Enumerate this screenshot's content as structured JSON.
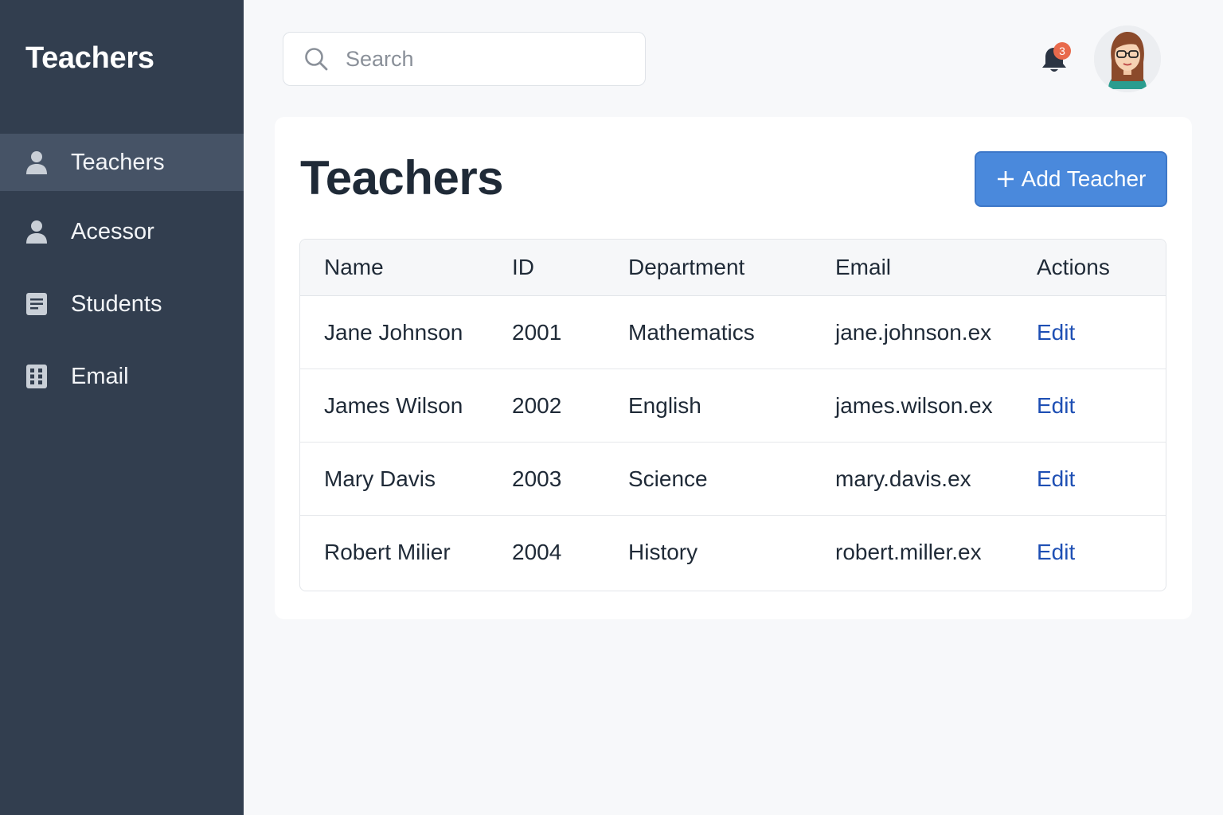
{
  "sidebar": {
    "title": "Teachers",
    "items": [
      {
        "label": "Teachers",
        "icon": "user-icon",
        "active": true
      },
      {
        "label": "Acessor",
        "icon": "user-icon",
        "active": false
      },
      {
        "label": "Students",
        "icon": "document-icon",
        "active": false
      },
      {
        "label": "Email",
        "icon": "grid-icon",
        "active": false
      }
    ]
  },
  "header": {
    "search_placeholder": "Search",
    "notifications_count": "3"
  },
  "main": {
    "title": "Teachers",
    "add_button_label": "Add Teacher",
    "table": {
      "columns": [
        "Name",
        "ID",
        "Department",
        "Email",
        "Actions"
      ],
      "rows": [
        {
          "name": "Jane Johnson",
          "id": "2001",
          "department": "Mathematics",
          "email": "jane.johnson.ex",
          "action": "Edit"
        },
        {
          "name": "James Wilson",
          "id": "2002",
          "department": "English",
          "email": "james.wilson.ex",
          "action": "Edit"
        },
        {
          "name": "Mary Davis",
          "id": "2003",
          "department": "Science",
          "email": "mary.davis.ex",
          "action": "Edit"
        },
        {
          "name": "Robert Milier",
          "id": "2004",
          "department": "History",
          "email": "robert.miller.ex",
          "action": "Edit"
        }
      ]
    }
  },
  "colors": {
    "sidebar_bg": "#323e4f",
    "sidebar_active": "#465366",
    "accent": "#4a89dc",
    "link": "#1e4fb4",
    "badge": "#e86a4c"
  }
}
